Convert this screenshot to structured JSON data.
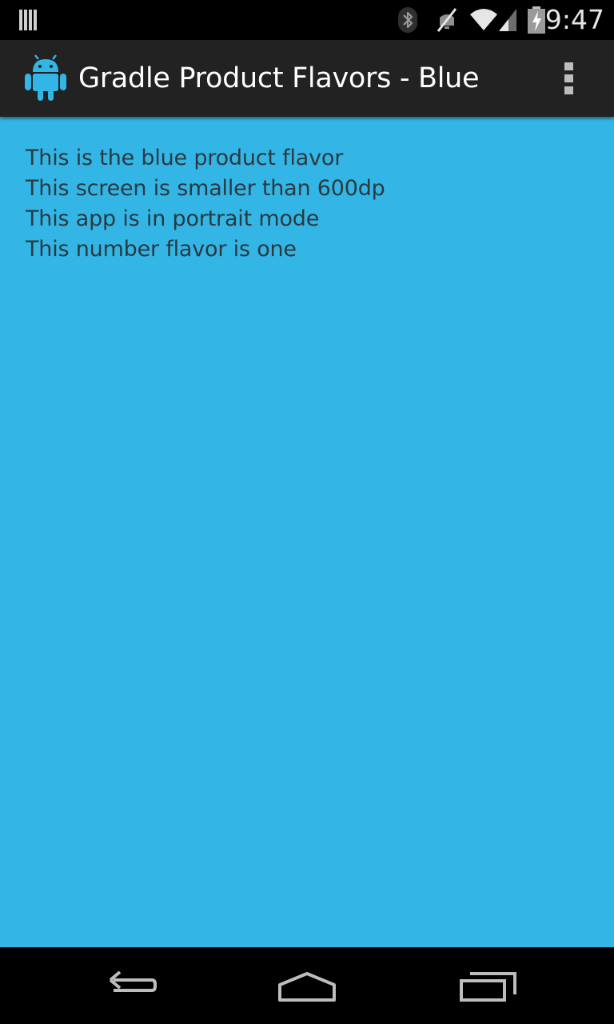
{
  "status_bar": {
    "time": "9:47",
    "icons": [
      "notification-bars-icon",
      "bluetooth-icon",
      "muted-icon",
      "wifi-icon",
      "signal-icon",
      "battery-charging-icon"
    ]
  },
  "action_bar": {
    "app_icon": "android-robot-icon",
    "title": "Gradle Product Flavors - Blue",
    "overflow_icon": "overflow-menu-icon"
  },
  "content": {
    "background_color": "#33b5e5",
    "lines": [
      "This is the blue product flavor",
      "This screen is smaller than 600dp",
      "This app is in portrait mode",
      "This number flavor is one"
    ]
  },
  "nav_bar": {
    "icons": [
      "back-icon",
      "home-icon",
      "recent-apps-icon"
    ]
  }
}
